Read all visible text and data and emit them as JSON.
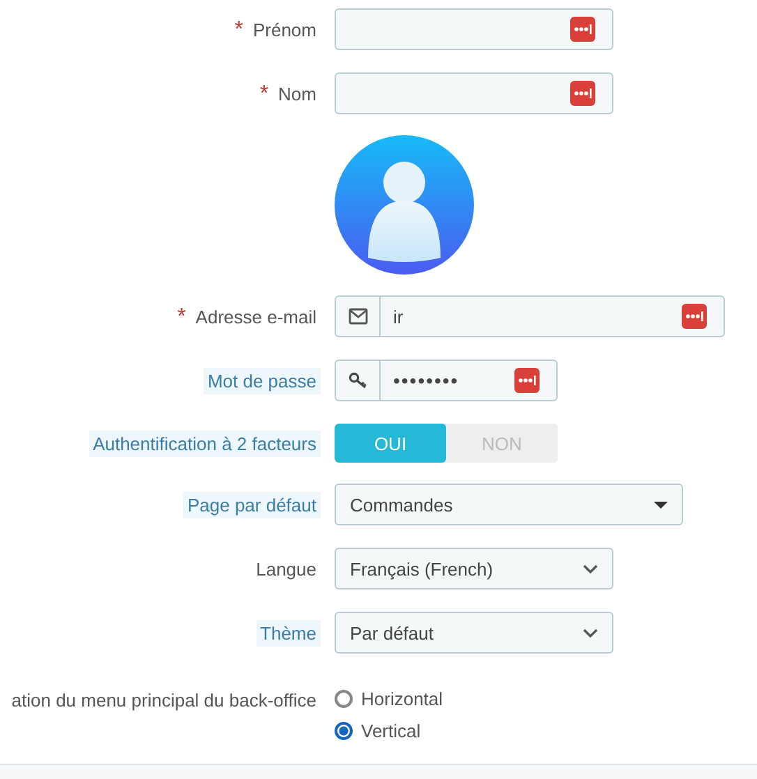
{
  "fields": [
    {
      "kind": "text",
      "label": "Prénom",
      "marker": "*",
      "help": false
    },
    {
      "kind": "text",
      "label": "Nom",
      "marker": "*",
      "help": false
    },
    {
      "kind": "avatar"
    },
    {
      "kind": "email",
      "label": "Adresse e-mail",
      "marker": "*",
      "help": false,
      "value": "ir"
    },
    {
      "kind": "password",
      "label": "Mot de passe",
      "help": true,
      "value": "••••••••"
    },
    {
      "kind": "toggle",
      "label": "Authentification à 2 facteurs",
      "help": true,
      "options": [
        {
          "label": "OUI",
          "selected": true
        },
        {
          "label": "NON",
          "selected": false
        }
      ]
    },
    {
      "kind": "dropdown",
      "label": "Page par défaut",
      "help": true,
      "value": "Commandes"
    },
    {
      "kind": "select",
      "label": "Langue",
      "help": false,
      "value": "Français (French)"
    },
    {
      "kind": "select",
      "label": "Thème",
      "help": true,
      "value": "Par défaut"
    },
    {
      "kind": "radio",
      "label": "ation du menu principal du back-office",
      "help": false,
      "options": [
        {
          "label": "Horizontal",
          "selected": false
        },
        {
          "label": "Vertical",
          "selected": true
        }
      ]
    }
  ]
}
